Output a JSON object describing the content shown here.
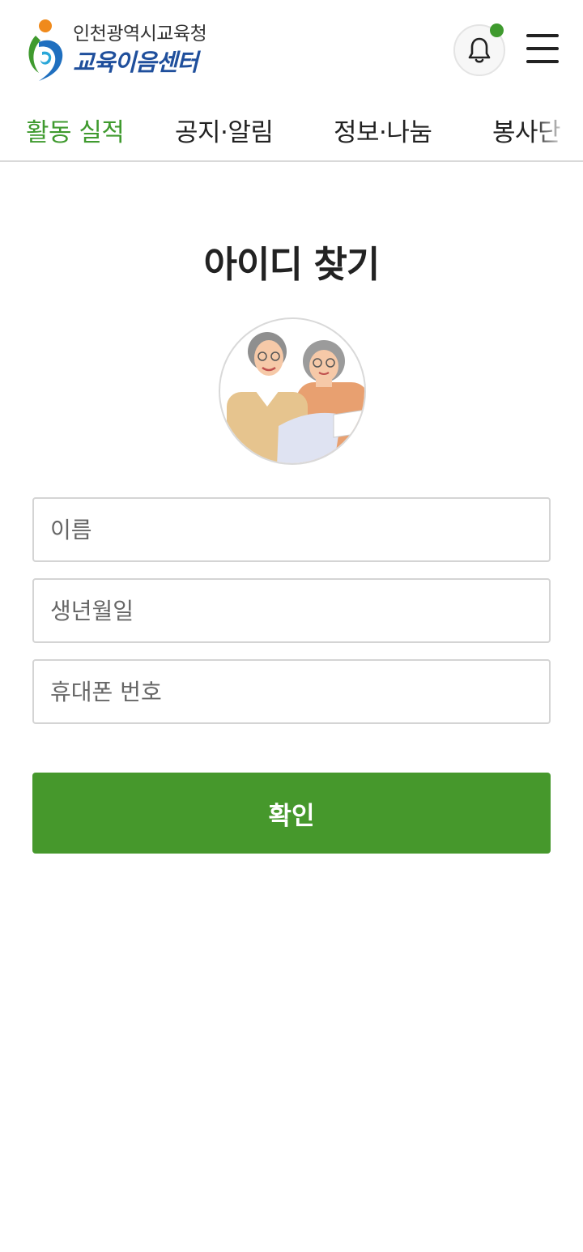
{
  "header": {
    "logo_top": "인천광역시교육청",
    "logo_bottom": "교육이음센터",
    "notification_icon": "bell-icon",
    "menu_icon": "hamburger-menu-icon"
  },
  "nav": {
    "tabs": [
      {
        "label": "활동 실적",
        "active": true
      },
      {
        "label": "공지·알림",
        "active": false
      },
      {
        "label": "정보·나눔",
        "active": false
      },
      {
        "label": "봉사단",
        "active": false
      }
    ]
  },
  "page": {
    "title": "아이디 찾기"
  },
  "form": {
    "name_placeholder": "이름",
    "birth_placeholder": "생년월일",
    "phone_placeholder": "휴대폰 번호",
    "submit_label": "확인"
  },
  "colors": {
    "accent": "#46982c",
    "active_tab": "#3f9a2e",
    "logo_text": "#1f4f9c"
  }
}
